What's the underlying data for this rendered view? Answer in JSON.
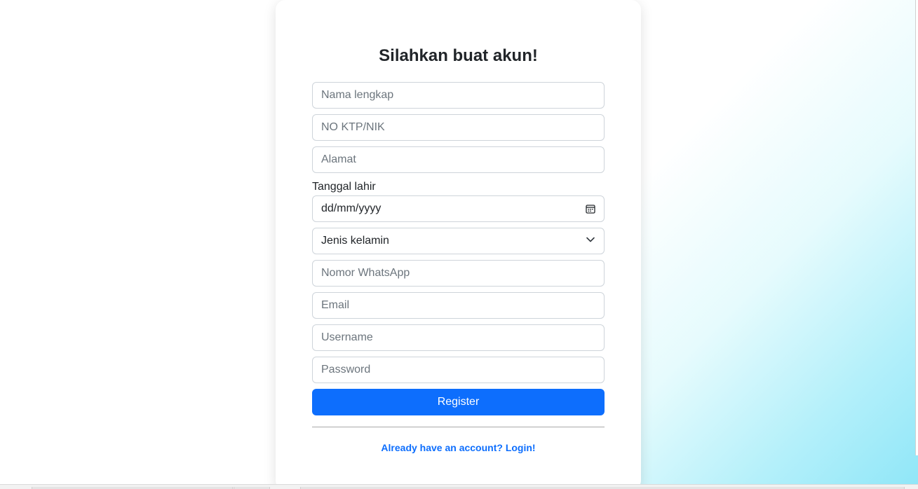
{
  "form": {
    "title": "Silahkan buat akun!",
    "fields": {
      "full_name_placeholder": "Nama lengkap",
      "ktp_placeholder": "NO KTP/NIK",
      "address_placeholder": "Alamat",
      "birthdate_label": "Tanggal lahir",
      "birthdate_placeholder": "dd/mm/yyyy",
      "gender_selected": "Jenis kelamin",
      "whatsapp_placeholder": "Nomor WhatsApp",
      "email_placeholder": "Email",
      "username_placeholder": "Username",
      "password_placeholder": "Password"
    },
    "register_label": "Register",
    "login_link": "Already have an account? Login!"
  },
  "icons": {
    "date": "calendar-icon",
    "select": "chevron-down-icon"
  },
  "colors": {
    "primary": "#0d6efd",
    "border": "#ced4da",
    "gradient_end": "#8fe6f8"
  }
}
